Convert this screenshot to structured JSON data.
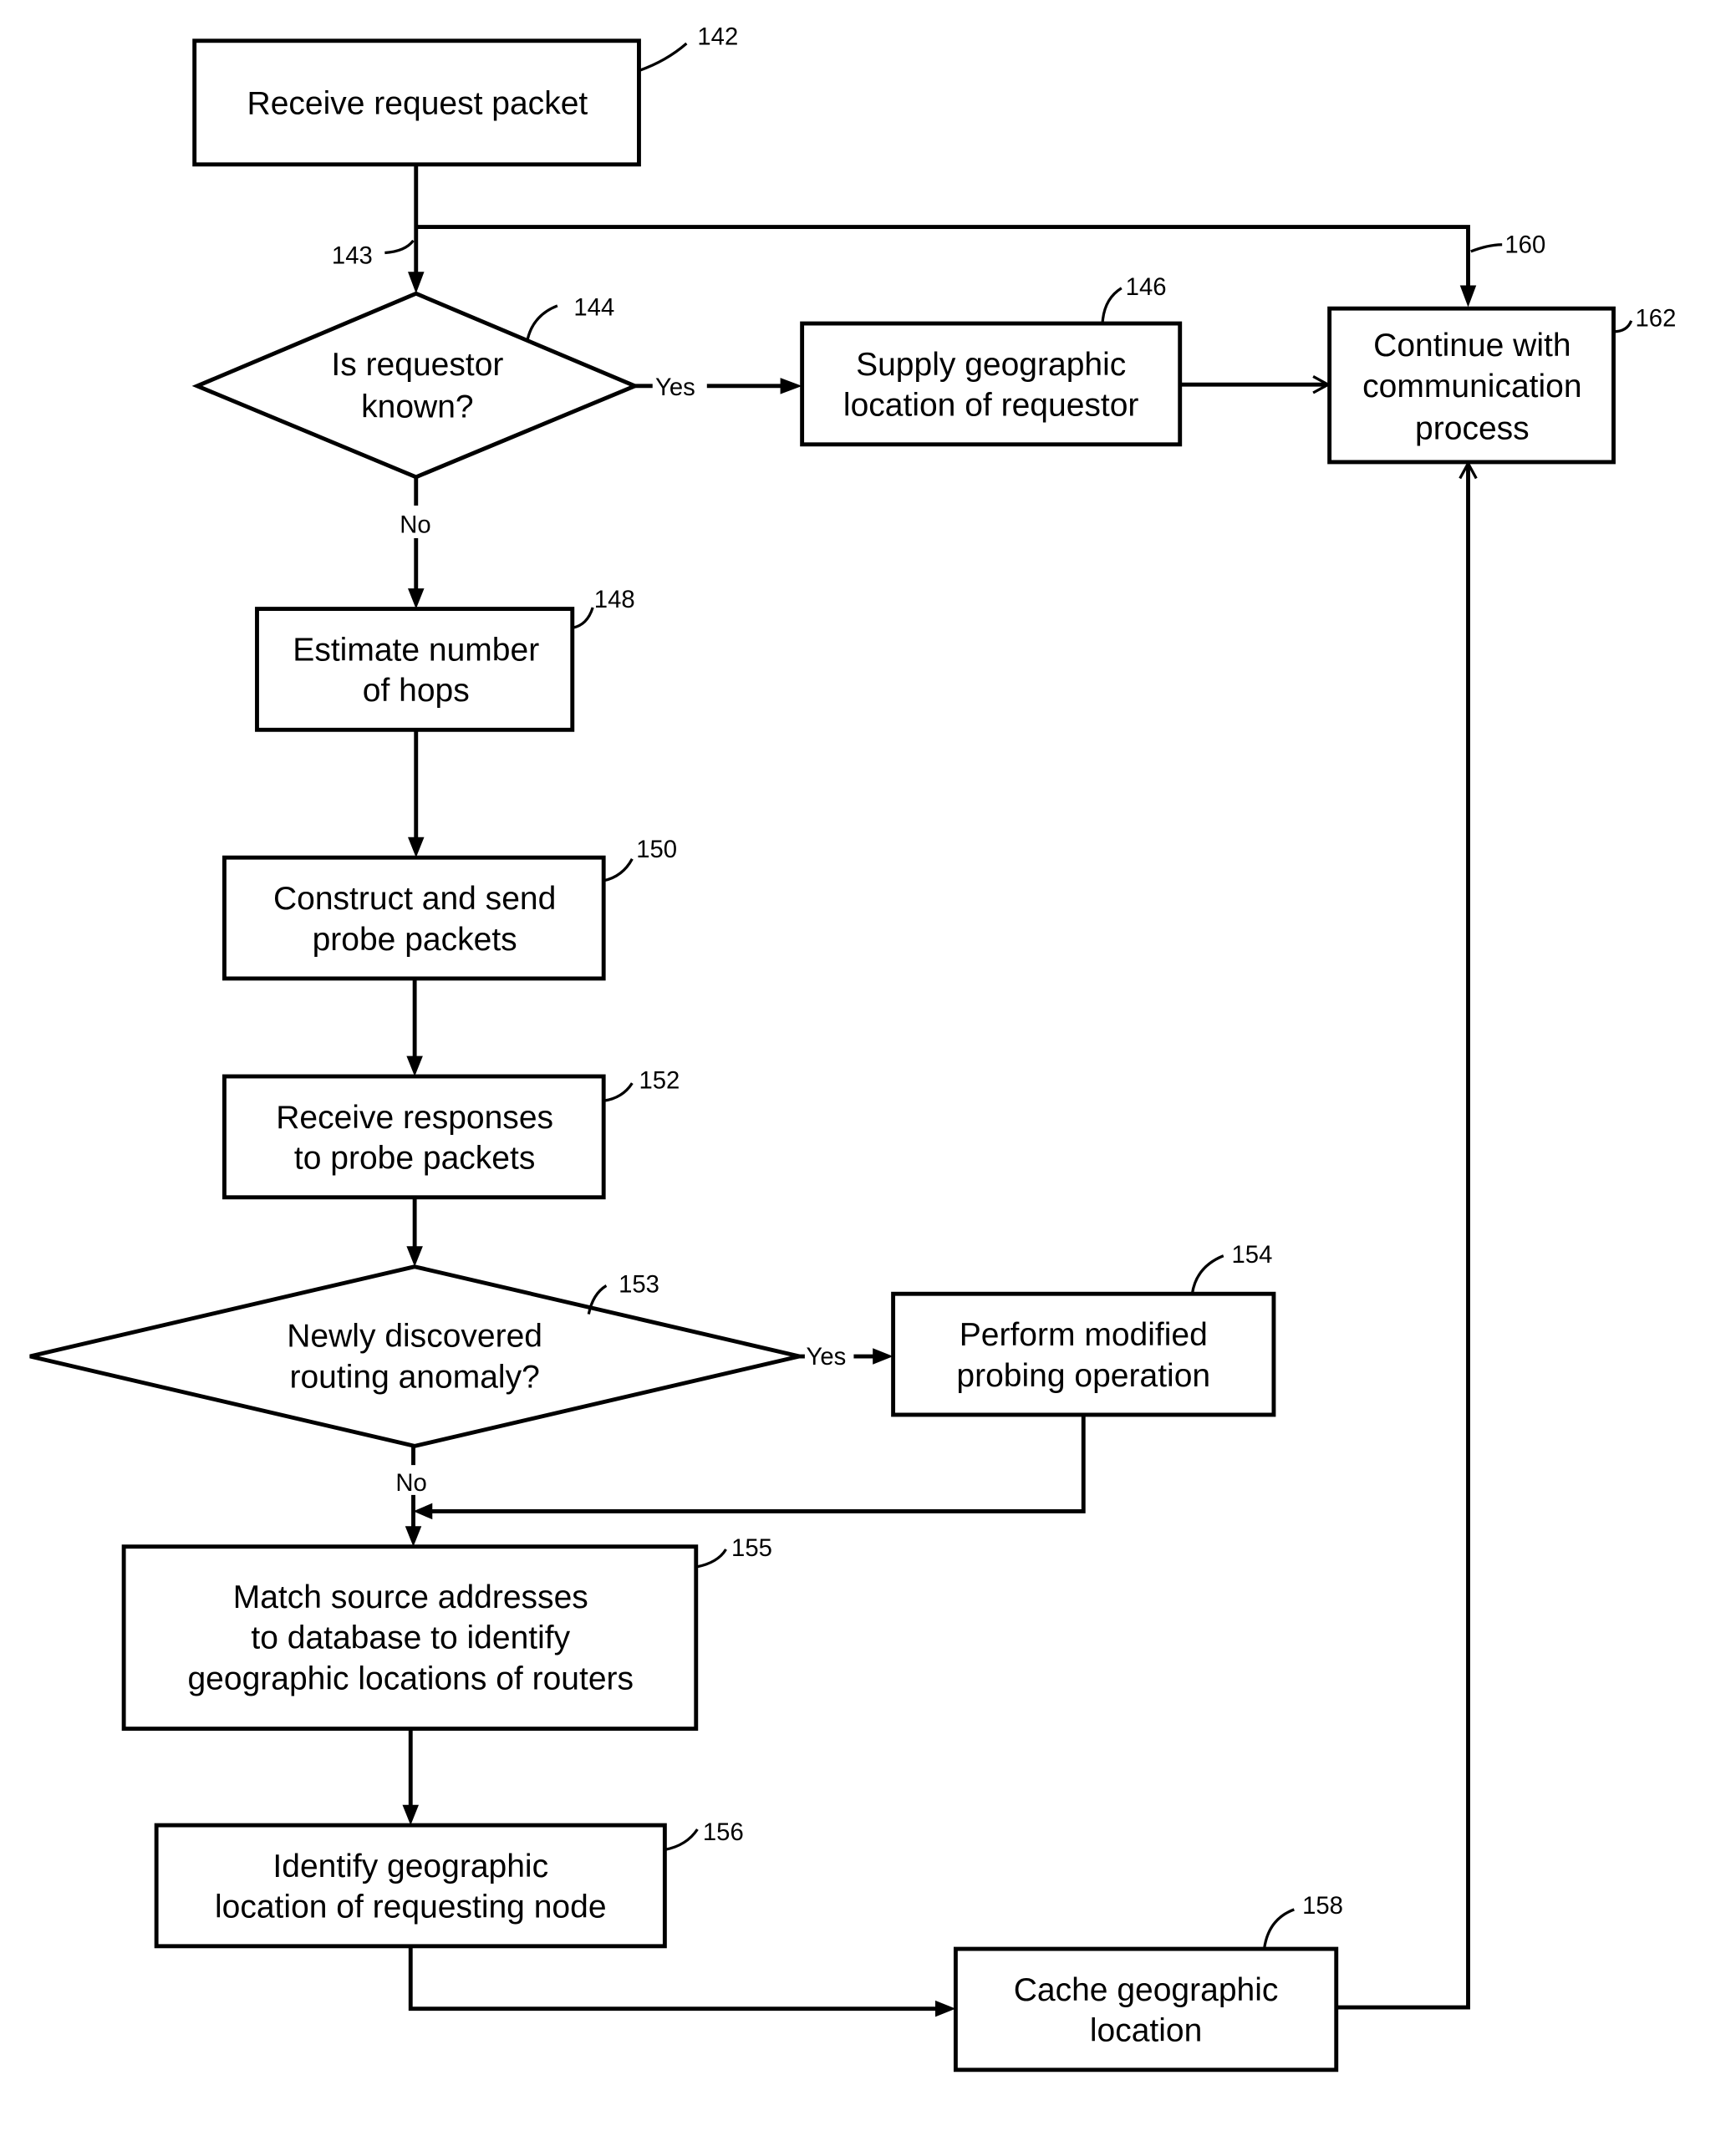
{
  "nodes": {
    "n142": {
      "ref": "142",
      "lines": [
        "Receive request packet"
      ]
    },
    "n144": {
      "ref": "144",
      "lines": [
        "Is requestor",
        "known?"
      ]
    },
    "n146": {
      "ref": "146",
      "lines": [
        "Supply geographic",
        "location of requestor"
      ]
    },
    "n162": {
      "ref": "162",
      "lines": [
        "Continue with",
        "communication",
        "process"
      ]
    },
    "n148": {
      "ref": "148",
      "lines": [
        "Estimate number",
        "of hops"
      ]
    },
    "n150": {
      "ref": "150",
      "lines": [
        "Construct and send",
        "probe packets"
      ]
    },
    "n152": {
      "ref": "152",
      "lines": [
        "Receive responses",
        "to probe packets"
      ]
    },
    "n153": {
      "ref": "153",
      "lines": [
        "Newly discovered",
        "routing anomaly?"
      ]
    },
    "n154": {
      "ref": "154",
      "lines": [
        "Perform modified",
        "probing operation"
      ]
    },
    "n155": {
      "ref": "155",
      "lines": [
        "Match source addresses",
        "to database to identify",
        "geographic locations of routers"
      ]
    },
    "n156": {
      "ref": "156",
      "lines": [
        "Identify geographic",
        "location of requesting node"
      ]
    },
    "n158": {
      "ref": "158",
      "lines": [
        "Cache geographic",
        "location"
      ]
    }
  },
  "connectors": {
    "c143": {
      "ref": "143"
    },
    "c160": {
      "ref": "160"
    }
  },
  "branches": {
    "b144_yes": "Yes",
    "b144_no": "No",
    "b153_yes": "Yes",
    "b153_no": "No"
  }
}
